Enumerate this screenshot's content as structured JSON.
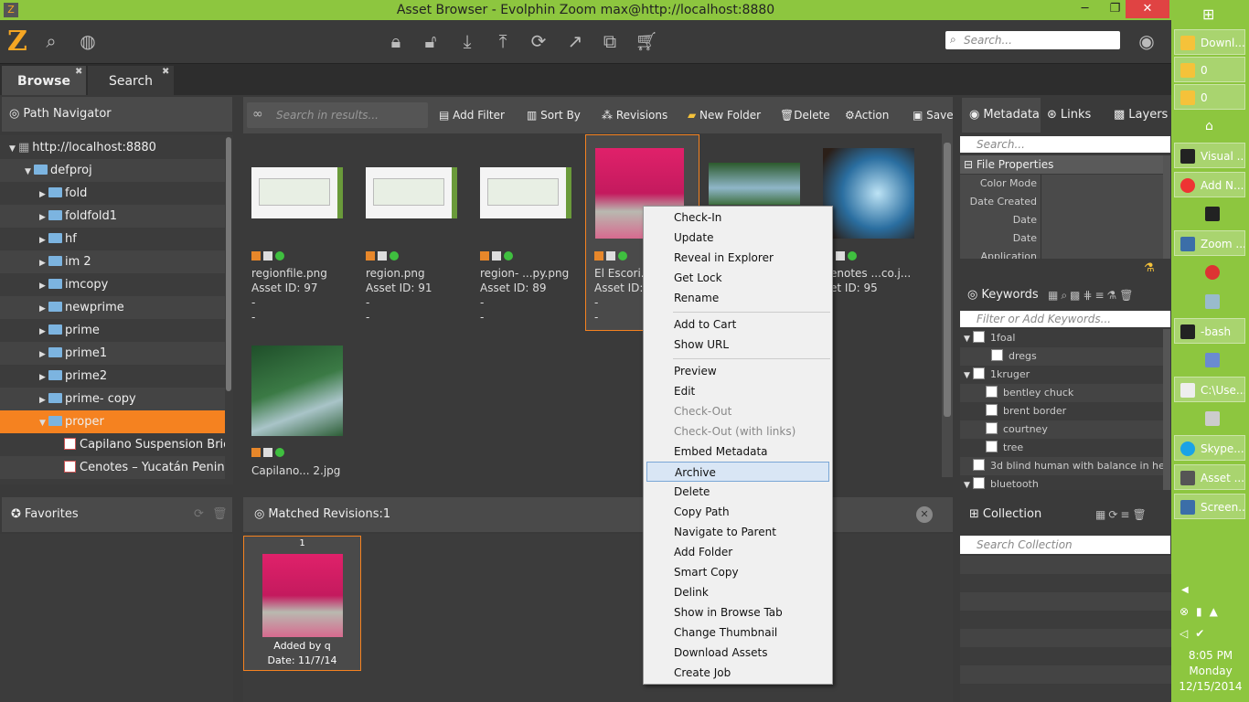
{
  "window": {
    "title": "Asset Browser - Evolphin Zoom max@http://localhost:8880"
  },
  "toolbar": {
    "search_placeholder": "Search..."
  },
  "tabs": [
    {
      "label": "Browse"
    },
    {
      "label": "Search"
    }
  ],
  "path_navigator": {
    "title": "Path Navigator",
    "items": [
      {
        "label": "http://localhost:8880"
      },
      {
        "label": "defproj"
      },
      {
        "label": "fold"
      },
      {
        "label": "foldfold1"
      },
      {
        "label": "hf"
      },
      {
        "label": "im 2"
      },
      {
        "label": "imcopy"
      },
      {
        "label": "newprime"
      },
      {
        "label": "prime"
      },
      {
        "label": "prime1"
      },
      {
        "label": "prime2"
      },
      {
        "label": "prime- copy"
      },
      {
        "label": "proper"
      },
      {
        "label": "Capilano Suspension Bric"
      },
      {
        "label": "Cenotes – Yucatán Penin"
      }
    ]
  },
  "results_toolbar": {
    "search_placeholder": "Search in results...",
    "add_filter": "Add Filter",
    "sort_by": "Sort By",
    "revisions": "Revisions",
    "new_folder": "New Folder",
    "delete": "Delete",
    "action": "Action",
    "save": "Save"
  },
  "assets": [
    {
      "name": "regionfile.png",
      "id": "Asset ID: 97",
      "l1": "-",
      "l2": "-"
    },
    {
      "name": "region.png",
      "id": "Asset ID: 91",
      "l1": "-",
      "l2": "-"
    },
    {
      "name": "region- ...py.png",
      "id": "Asset ID: 89",
      "l1": "-",
      "l2": "-"
    },
    {
      "name": "El Escori...",
      "id": "Asset ID:",
      "l1": "-",
      "l2": "-"
    },
    {
      "name": "",
      "id": "",
      "l1": "",
      "l2": ""
    },
    {
      "name": "enotes ...co.j...",
      "id": "et ID: 95",
      "l1": "",
      "l2": ""
    },
    {
      "name": "Capilano... 2.jpg",
      "id": "",
      "l1": "",
      "l2": ""
    }
  ],
  "context_menu": {
    "items": [
      {
        "label": "Check-In"
      },
      {
        "label": "Update"
      },
      {
        "label": "Reveal in Explorer"
      },
      {
        "label": "Get Lock"
      },
      {
        "label": "Rename"
      },
      {
        "label": "Add to Cart"
      },
      {
        "label": "Show URL"
      },
      {
        "label": "Preview"
      },
      {
        "label": "Edit"
      },
      {
        "label": "Check-Out"
      },
      {
        "label": "Check-Out (with links)"
      },
      {
        "label": "Embed Metadata"
      },
      {
        "label": "Archive"
      },
      {
        "label": "Delete"
      },
      {
        "label": "Copy Path"
      },
      {
        "label": "Navigate to Parent"
      },
      {
        "label": "Add Folder"
      },
      {
        "label": "Smart Copy"
      },
      {
        "label": "Delink"
      },
      {
        "label": "Show in Browse Tab"
      },
      {
        "label": "Change Thumbnail"
      },
      {
        "label": "Download Assets"
      },
      {
        "label": "Create Job"
      }
    ]
  },
  "favorites": {
    "title": "Favorites"
  },
  "matched": {
    "title": "Matched Revisions:1",
    "number": "1",
    "added_by": "Added by q",
    "date": "Date: 11/7/14"
  },
  "right_tabs": {
    "metadata": "Metadata",
    "links": "Links",
    "layers": "Layers"
  },
  "metadata": {
    "search_placeholder": "Search...",
    "section": "File Properties",
    "fields": [
      {
        "label": "Color Mode"
      },
      {
        "label": "Date Created"
      },
      {
        "label": "Date"
      },
      {
        "label": "Date"
      },
      {
        "label": "Application"
      }
    ]
  },
  "keywords": {
    "title": "Keywords",
    "filter_placeholder": "Filter or Add Keywords...",
    "items": [
      {
        "label": "1foal"
      },
      {
        "label": "dregs"
      },
      {
        "label": "1kruger"
      },
      {
        "label": "bentley chuck"
      },
      {
        "label": "brent border"
      },
      {
        "label": "courtney"
      },
      {
        "label": "tree"
      },
      {
        "label": "3d blind human with balance in he"
      },
      {
        "label": "bluetooth"
      }
    ]
  },
  "collection": {
    "title": "Collection",
    "search_placeholder": "Search Collection"
  },
  "taskbar": {
    "items": [
      {
        "label": "Downl..."
      },
      {
        "label": "0"
      },
      {
        "label": "0"
      },
      {
        "label": ""
      },
      {
        "label": "Visual ..."
      },
      {
        "label": "Add N..."
      },
      {
        "label": ""
      },
      {
        "label": "Zoom ..."
      },
      {
        "label": ""
      },
      {
        "label": ""
      },
      {
        "label": "-bash"
      },
      {
        "label": ""
      },
      {
        "label": "C:\\Use..."
      },
      {
        "label": ""
      },
      {
        "label": "Skype..."
      },
      {
        "label": "Asset ..."
      },
      {
        "label": "Screen..."
      }
    ],
    "time": "8:05 PM",
    "day": "Monday",
    "date": "12/15/2014"
  }
}
